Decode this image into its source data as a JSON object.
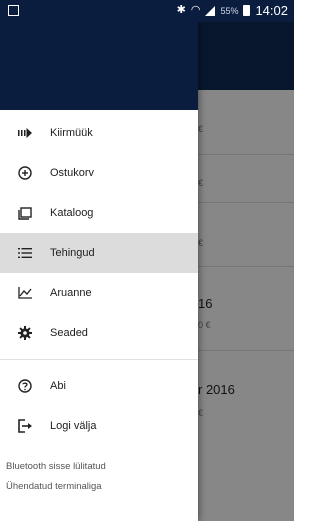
{
  "status_bar": {
    "battery_percent": "55%",
    "time": "14:02"
  },
  "background": {
    "rows": [
      {
        "t1": "",
        "t2": "€"
      },
      {
        "t1": "",
        "t2": "€"
      },
      {
        "t1": "",
        "t2": "€"
      },
      {
        "t1": "16",
        "t2": "0 €"
      },
      {
        "t1": "r 2016",
        "t2": "€"
      }
    ]
  },
  "drawer": {
    "menu": [
      {
        "id": "kiirmuuk",
        "label": "Kiirmüük",
        "icon": "fast-forward-icon",
        "active": false
      },
      {
        "id": "ostukorv",
        "label": "Ostukorv",
        "icon": "add-circle-icon",
        "active": false
      },
      {
        "id": "kataloog",
        "label": "Kataloog",
        "icon": "catalog-icon",
        "active": false
      },
      {
        "id": "tehingud",
        "label": "Tehingud",
        "icon": "list-icon",
        "active": true
      },
      {
        "id": "aruanne",
        "label": "Aruanne",
        "icon": "chart-icon",
        "active": false
      },
      {
        "id": "seaded",
        "label": "Seaded",
        "icon": "gear-icon",
        "active": false
      }
    ],
    "secondary": [
      {
        "id": "abi",
        "label": "Abi",
        "icon": "help-icon"
      },
      {
        "id": "logout",
        "label": "Logi välja",
        "icon": "logout-icon"
      }
    ],
    "status_lines": [
      "Bluetooth sisse lülitatud",
      "Ühendatud terminaliga"
    ]
  }
}
